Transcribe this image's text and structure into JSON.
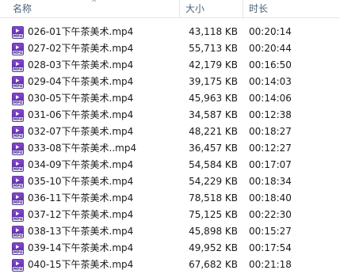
{
  "header": {
    "name_label": "名称",
    "size_label": "大小",
    "duration_label": "时长"
  },
  "icon": {
    "name": "mp4-video-file-icon",
    "label": "MP4",
    "color_top": "#8e44d6",
    "color_bottom": "#4a2a9a"
  },
  "files": [
    {
      "name": "026-01下午茶美术.mp4",
      "size": "43,118 KB",
      "duration": "00:20:14"
    },
    {
      "name": "027-02下午茶美术.mp4",
      "size": "55,713 KB",
      "duration": "00:20:44"
    },
    {
      "name": "028-03下午茶美术.mp4",
      "size": "42,179 KB",
      "duration": "00:16:50"
    },
    {
      "name": "029-04下午茶美术.mp4",
      "size": "39,175 KB",
      "duration": "00:14:03"
    },
    {
      "name": "030-05下午茶美术.mp4",
      "size": "45,963 KB",
      "duration": "00:14:06"
    },
    {
      "name": "031-06下午茶美术.mp4",
      "size": "34,587 KB",
      "duration": "00:12:38"
    },
    {
      "name": "032-07下午茶美术.mp4",
      "size": "48,221 KB",
      "duration": "00:18:27"
    },
    {
      "name": "033-08下午茶美术..mp4",
      "size": "36,457 KB",
      "duration": "00:12:27"
    },
    {
      "name": "034-09下午茶美术.mp4",
      "size": "54,584 KB",
      "duration": "00:17:07"
    },
    {
      "name": "035-10下午茶美术.mp4",
      "size": "54,229 KB",
      "duration": "00:18:34"
    },
    {
      "name": "036-11下午茶美术.mp4",
      "size": "78,518 KB",
      "duration": "00:18:40"
    },
    {
      "name": "037-12下午茶美术.mp4",
      "size": "75,125 KB",
      "duration": "00:22:30"
    },
    {
      "name": "038-13下午茶美术.mp4",
      "size": "45,898 KB",
      "duration": "00:15:27"
    },
    {
      "name": "039-14下午茶美术.mp4",
      "size": "49,952 KB",
      "duration": "00:17:54"
    },
    {
      "name": "040-15下午茶美术.mp4",
      "size": "67,682 KB",
      "duration": "00:21:18"
    }
  ]
}
